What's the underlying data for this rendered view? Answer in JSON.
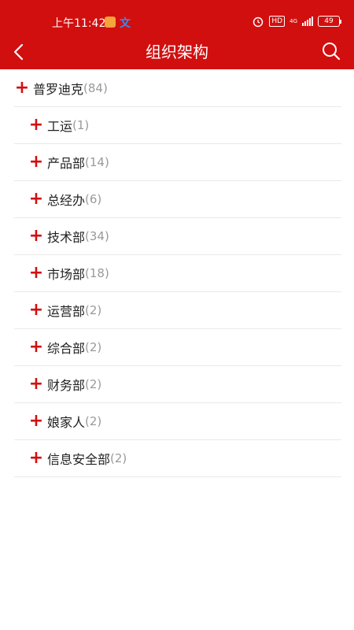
{
  "status_bar": {
    "time": "上午11:42",
    "app1_icon": "message-app-icon",
    "app2_icon": "translate-app-icon",
    "app2_glyph": "文",
    "hd": "HD",
    "network": "4G",
    "battery": "49"
  },
  "header": {
    "title": "组织架构",
    "back_icon": "chevron-left-icon",
    "search_icon": "search-icon",
    "background": "#d20f0f"
  },
  "tree": {
    "root": {
      "name": "普罗迪克",
      "count": "(84)",
      "icon": "plus-icon"
    },
    "children": [
      {
        "name": "工运",
        "count": "(1)"
      },
      {
        "name": "产品部",
        "count": "(14)"
      },
      {
        "name": "总经办",
        "count": "(6)"
      },
      {
        "name": "技术部",
        "count": "(34)"
      },
      {
        "name": "市场部",
        "count": "(18)"
      },
      {
        "name": "运营部",
        "count": "(2)"
      },
      {
        "name": "综合部",
        "count": "(2)"
      },
      {
        "name": "财务部",
        "count": "(2)"
      },
      {
        "name": "娘家人",
        "count": "(2)"
      },
      {
        "name": "信息安全部",
        "count": "(2)"
      }
    ]
  }
}
